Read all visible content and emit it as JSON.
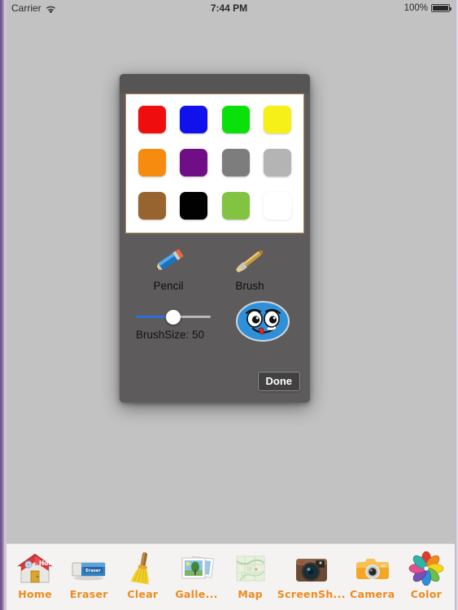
{
  "status_bar": {
    "carrier": "Carrier",
    "wifi_icon": "wifi-icon",
    "time": "7:44 PM",
    "battery_percent": "100%",
    "battery_icon": "battery-icon"
  },
  "modal": {
    "colors": {
      "swatches": [
        {
          "name": "red",
          "hex": "#ef0d0d"
        },
        {
          "name": "blue",
          "hex": "#1111ee"
        },
        {
          "name": "green",
          "hex": "#0ae00a"
        },
        {
          "name": "yellow",
          "hex": "#f7ef18"
        },
        {
          "name": "orange",
          "hex": "#f78b10"
        },
        {
          "name": "purple",
          "hex": "#700f85"
        },
        {
          "name": "gray",
          "hex": "#7d7d7d"
        },
        {
          "name": "light-gray",
          "hex": "#b4b4b4"
        },
        {
          "name": "brown",
          "hex": "#97642f"
        },
        {
          "name": "black",
          "hex": "#010101"
        },
        {
          "name": "lime-green",
          "hex": "#82c341"
        },
        {
          "name": "white",
          "hex": "#ffffff"
        }
      ],
      "panel_border": "#b58a55"
    },
    "tools": [
      {
        "name": "pencil",
        "label": "Pencil"
      },
      {
        "name": "brush",
        "label": "Brush"
      }
    ],
    "brush_size": {
      "label": "BrushSize: 50",
      "value": 50,
      "min": 0,
      "max": 100,
      "fill_color": "#2d6fd4",
      "track_color": "#b9b9b9"
    },
    "smiley": {
      "name": "smiley-face-stamp",
      "color": "#2f8fd8"
    },
    "done_label": "Done"
  },
  "tabbar": {
    "items": [
      {
        "icon": "home-icon",
        "label": "Home"
      },
      {
        "icon": "eraser-icon",
        "label": "Eraser"
      },
      {
        "icon": "broom-icon",
        "label": "Clear"
      },
      {
        "icon": "gallery-icon",
        "label": "Galle..."
      },
      {
        "icon": "map-icon",
        "label": "Map"
      },
      {
        "icon": "screenshot-icon",
        "label": "ScreenSh..."
      },
      {
        "icon": "camera-icon",
        "label": "Camera"
      },
      {
        "icon": "color-icon",
        "label": "Color"
      }
    ],
    "label_color": "#f08a1e"
  }
}
